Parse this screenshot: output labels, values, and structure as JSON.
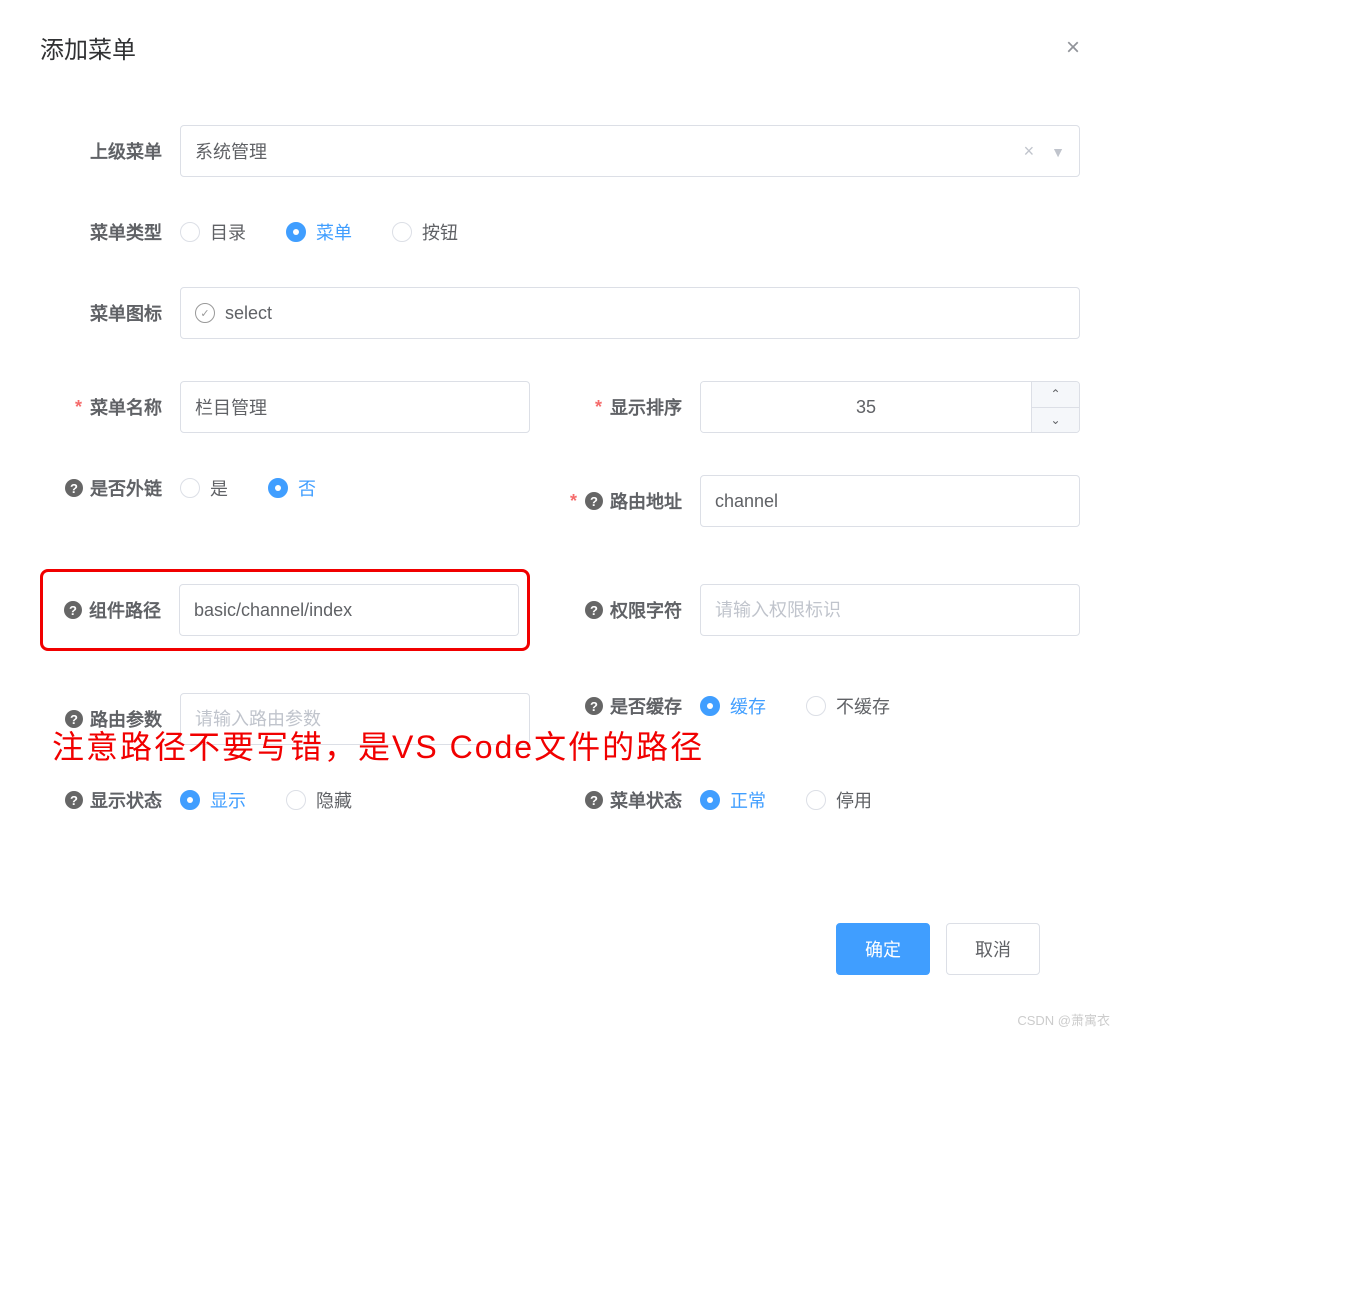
{
  "dialog": {
    "title": "添加菜单",
    "close_label": "×"
  },
  "fields": {
    "parent_menu": {
      "label": "上级菜单",
      "value": "系统管理"
    },
    "menu_type": {
      "label": "菜单类型",
      "options": {
        "directory": "目录",
        "menu": "菜单",
        "button": "按钮"
      }
    },
    "menu_icon": {
      "label": "菜单图标",
      "value": "select"
    },
    "menu_name": {
      "label": "菜单名称",
      "value": "栏目管理"
    },
    "display_order": {
      "label": "显示排序",
      "value": "35"
    },
    "is_external": {
      "label": "是否外链",
      "options": {
        "yes": "是",
        "no": "否"
      }
    },
    "route_address": {
      "label": "路由地址",
      "value": "channel"
    },
    "component_path": {
      "label": "组件路径",
      "value": "basic/channel/index"
    },
    "permission": {
      "label": "权限字符",
      "placeholder": "请输入权限标识"
    },
    "route_params": {
      "label": "路由参数",
      "placeholder": "请输入路由参数"
    },
    "is_cache": {
      "label": "是否缓存",
      "options": {
        "cache": "缓存",
        "nocache": "不缓存"
      }
    },
    "display_status": {
      "label": "显示状态",
      "options": {
        "show": "显示",
        "hide": "隐藏"
      }
    },
    "menu_status": {
      "label": "菜单状态",
      "options": {
        "normal": "正常",
        "disabled": "停用"
      }
    }
  },
  "annotation": "注意路径不要写错，是VS Code文件的路径",
  "buttons": {
    "confirm": "确定",
    "cancel": "取消"
  },
  "watermark": "CSDN @萧寓衣"
}
